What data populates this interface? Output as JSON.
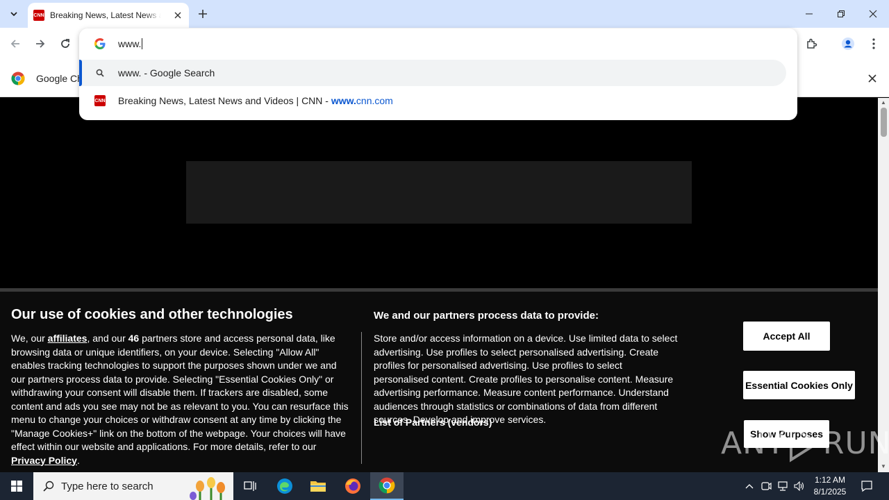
{
  "browser": {
    "tab": {
      "favicon_text": "CNN",
      "title": "Breaking News, Latest News and Videos | CNN"
    },
    "omnibox": {
      "input_value": "www.",
      "suggestions": [
        {
          "text": "www. - Google Search",
          "icon": "search-icon"
        },
        {
          "text_prefix": "Breaking News, Latest News and Videos | CNN - ",
          "url_bold": "www.",
          "url_rest": "cnn.com",
          "icon": "cnn-favicon"
        }
      ]
    },
    "infobar": {
      "text": "Google Chrome isn't your default browser"
    },
    "accent_color": "#0b57d0"
  },
  "cookie_banner": {
    "title": "Our use of cookies and other technologies",
    "lead_1": "We, our ",
    "affiliates": "affiliates",
    "lead_2": ", and our ",
    "partner_count": "46",
    "lead_3": " partners store and access personal data, like browsing data or unique identifiers, on your device. Selecting \"Allow All\" enables tracking technologies to support the purposes shown under we and our partners process data to provide. Selecting \"Essential Cookies Only\" or withdrawing your consent will disable them. If trackers are disabled, some content and ads you see may not be as relevant to you. You can resurface this menu to change your choices or withdraw consent at any time by clicking the \"Manage Cookies+\" link on the bottom of the webpage. Your choices will have effect within our website and applications. For more details, refer to our ",
    "privacy_policy": "Privacy Policy",
    "lead_end": ".",
    "purposes_title": "We and our partners process data to provide:",
    "purposes_text": "Store and/or access information on a device. Use limited data to select advertising. Use profiles to select personalised advertising. Create profiles for personalised advertising. Use profiles to select personalised content. Create profiles to personalise content. Measure advertising performance. Measure content performance. Understand audiences through statistics or combinations of data from different sources. Develop and improve services.",
    "partners_link": "List of Partners (vendors)",
    "accept_all": "Accept All",
    "essential_only": "Essential Cookies Only",
    "show_purposes": "Show Purposes"
  },
  "watermark": {
    "left": "ANY",
    "right": "RUN"
  },
  "taskbar": {
    "search_placeholder": "Type here to search",
    "time": "1:12 AM",
    "date": "8/1/2025"
  }
}
